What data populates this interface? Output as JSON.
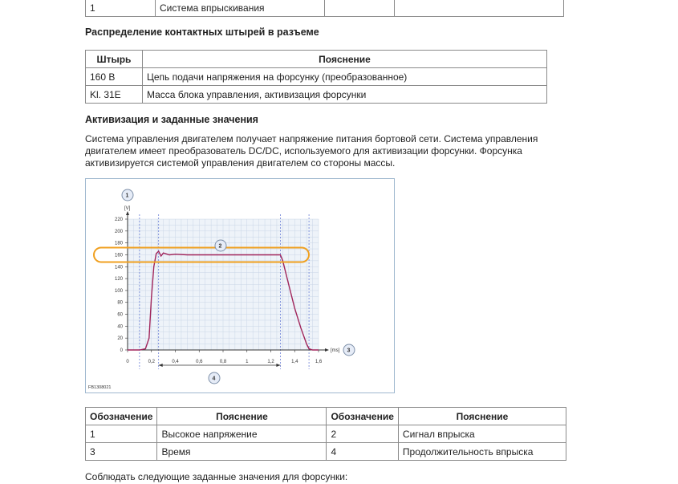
{
  "top_table": {
    "row": [
      "1",
      "Система впрыскивания",
      "",
      ""
    ]
  },
  "pins_section": {
    "heading": "Распределение контактных штырей в разъеме",
    "headers": [
      "Штырь",
      "Пояснение"
    ],
    "rows": [
      [
        "160 B",
        "Цепь подачи напряжения на форсунку (преобразованное)"
      ],
      [
        "Kl. 31E",
        "Масса блока управления, активизация форсунки"
      ]
    ]
  },
  "activation_section": {
    "heading": "Активизация и заданные значения",
    "paragraph": "Система управления двигателем получает напряжение питания бортовой сети. Система управления двигателем имеет преобразователь DC/DC, используемого для активизации форсунки. Форсунка активизируется системой управления двигателем со стороны массы."
  },
  "figure": {
    "code": "FB1308021",
    "callouts": [
      "1",
      "2",
      "3",
      "4"
    ],
    "y_unit": "[V]",
    "x_unit": "[ms]",
    "colors": {
      "signal": "#a0245a",
      "highlight": "#f0a020",
      "grid": "#c9d6e6",
      "marker": "#6b7fd6"
    }
  },
  "chart_data": {
    "type": "line",
    "title": "",
    "xlabel": "[ms]",
    "ylabel": "[V]",
    "xlim": [
      0,
      1.6
    ],
    "ylim": [
      0,
      220
    ],
    "xticks": [
      "0",
      "0,2",
      "0,4",
      "0,6",
      "0,8",
      "1",
      "1,2",
      "1,4",
      "1,6"
    ],
    "yticks": [
      "0",
      "20",
      "40",
      "60",
      "80",
      "100",
      "120",
      "140",
      "160",
      "180",
      "200",
      "220"
    ],
    "grid": true,
    "series": [
      {
        "x": [
          0,
          0.1,
          0.15,
          0.18,
          0.2,
          0.22,
          0.24,
          0.26,
          0.28,
          0.3,
          0.35,
          0.4,
          0.5,
          0.8,
          1.0,
          1.2,
          1.28,
          1.3,
          1.35,
          1.4,
          1.45,
          1.5,
          1.52,
          1.55,
          1.6
        ],
        "y": [
          0,
          0,
          2,
          20,
          90,
          140,
          162,
          166,
          158,
          163,
          160,
          161,
          160,
          160,
          160,
          160,
          160,
          150,
          110,
          70,
          38,
          10,
          2,
          0,
          0
        ]
      }
    ],
    "markers_x": [
      0.1,
      0.26,
      1.28,
      1.52
    ],
    "highlight_level": 160,
    "duration_arrow": [
      0.26,
      1.28
    ]
  },
  "legend_table": {
    "headers": [
      "Обозначение",
      "Пояснение",
      "Обозначение",
      "Пояснение"
    ],
    "rows": [
      [
        "1",
        "Высокое напряжение",
        "2",
        "Сигнал впрыска"
      ],
      [
        "3",
        "Время",
        "4",
        "Продолжительность впрыска"
      ]
    ]
  },
  "footer_text": "Соблюдать следующие заданные значения для форсунки:"
}
